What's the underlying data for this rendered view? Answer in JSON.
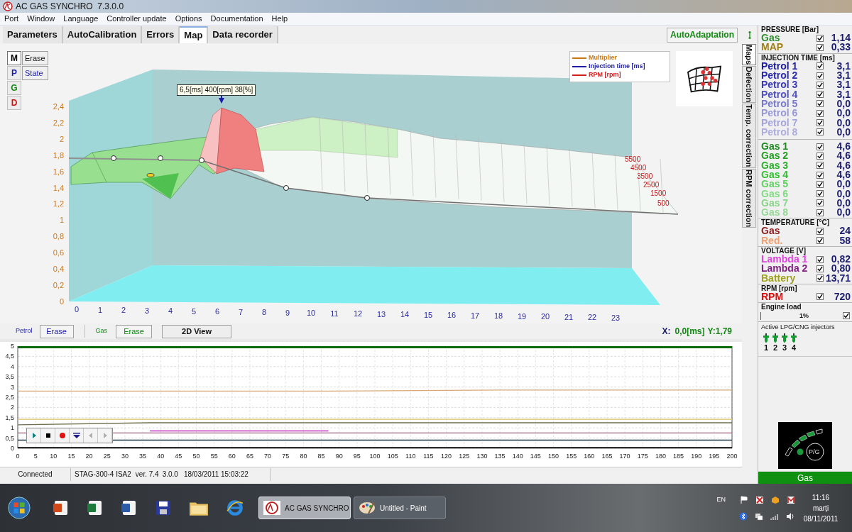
{
  "window": {
    "title": "AC GAS SYNCHRO  7.3.0.0"
  },
  "menu": [
    "Port",
    "Window",
    "Language",
    "Controller update",
    "Options",
    "Documentation",
    "Help"
  ],
  "tabs": [
    {
      "label": "Parameters",
      "selected": false
    },
    {
      "label": "AutoCalibration",
      "selected": false
    },
    {
      "label": "Errors",
      "selected": false
    },
    {
      "label": "Map",
      "selected": true
    },
    {
      "label": "Data recorder",
      "selected": false
    }
  ],
  "auto_adaptation": "AutoAdaptation",
  "side_tabs": [
    {
      "label": "Maps",
      "selected": true
    },
    {
      "label": "Defection",
      "selected": false
    },
    {
      "label": "Temp. correction",
      "selected": false
    },
    {
      "label": "RPM correction",
      "selected": false
    }
  ],
  "map": {
    "modes": [
      {
        "label": "M",
        "color": "#000000",
        "selected": true
      },
      {
        "label": "P",
        "color": "#1c1ca8",
        "selected": false
      },
      {
        "label": "G",
        "color": "#118811",
        "selected": false
      },
      {
        "label": "D",
        "color": "#cc1111",
        "selected": false
      }
    ],
    "mode_buttons": [
      "Erase",
      "State"
    ],
    "legend": [
      {
        "label": "Multiplier",
        "color": "#c87810"
      },
      {
        "label": "Injection time [ms]",
        "color": "#1c1ca8"
      },
      {
        "label": "RPM [rpm]",
        "color": "#d02020"
      }
    ],
    "tooltip": "6,5[ms] 400[rpm] 38[%]",
    "y_ticks": [
      "2,4",
      "2,2",
      "2",
      "1,8",
      "1,6",
      "1,4",
      "1,2",
      "1",
      "0,8",
      "0,6",
      "0,4",
      "0,2",
      "0"
    ],
    "x_ticks": [
      "0",
      "1",
      "2",
      "3",
      "4",
      "5",
      "6",
      "7",
      "8",
      "9",
      "10",
      "11",
      "12",
      "13",
      "14",
      "15",
      "16",
      "17",
      "18",
      "19",
      "20",
      "21",
      "22",
      "23"
    ],
    "rpm_ticks": [
      "5500",
      "4500",
      "3500",
      "2500",
      "1500",
      "500"
    ]
  },
  "map_controls": {
    "petrol_label": "Petrol",
    "petrol_erase": "Erase",
    "gas_label": "Gas",
    "gas_erase": "Erase",
    "view_button": "2D View",
    "x_label": "X:",
    "x_value": "0,0[ms]",
    "y_label": "Y:",
    "y_value": "1,79"
  },
  "recorder": {
    "chart_data": {
      "type": "line",
      "grid": true,
      "x": [
        0,
        37,
        87,
        135,
        200
      ],
      "xlim": [
        0,
        200
      ],
      "ylim": [
        0,
        5
      ],
      "xticks": [
        0,
        5,
        10,
        15,
        20,
        25,
        30,
        35,
        40,
        45,
        50,
        55,
        60,
        65,
        70,
        75,
        80,
        85,
        90,
        95,
        100,
        105,
        110,
        115,
        120,
        125,
        130,
        135,
        140,
        145,
        150,
        155,
        160,
        165,
        170,
        175,
        180,
        185,
        190,
        195,
        200
      ],
      "yticks": [
        0,
        {
          "value": 0.5,
          "label": "0,5"
        },
        1,
        {
          "value": 1.5,
          "label": "1,5"
        },
        2,
        {
          "value": 2.5,
          "label": "2,5"
        },
        3,
        {
          "value": 3.5,
          "label": "3,5"
        },
        4,
        {
          "value": 4.5,
          "label": "4,5"
        },
        5
      ],
      "series": [
        {
          "color": "#0b6a0b",
          "values": [
            4.95,
            4.95,
            4.95,
            4.95,
            4.95
          ]
        },
        {
          "color": "#d8a878",
          "values": [
            2.8,
            2.8,
            2.8,
            2.85,
            2.85
          ]
        },
        {
          "color": "#d8c060",
          "values": [
            1.42,
            1.42,
            1.42,
            1.42,
            1.42
          ]
        },
        {
          "color": "#707050",
          "values": [
            1.15,
            1.25,
            1.25,
            1.25,
            1.25
          ]
        },
        {
          "color": "#c030c0",
          "values": [
            null,
            0.85,
            0.85,
            null,
            null
          ]
        },
        {
          "color": "#a06080",
          "values": [
            0.75,
            0.75,
            0.75,
            0.75,
            0.75
          ]
        },
        {
          "color": "#203848",
          "values": [
            0.4,
            0.4,
            0.4,
            0.4,
            0.4
          ]
        },
        {
          "color": "#000000",
          "values": [
            0.05,
            0.05,
            0.05,
            0.05,
            0.05
          ]
        }
      ]
    },
    "player": [
      {
        "kind": "play",
        "disabled": false
      },
      {
        "kind": "stop",
        "disabled": false
      },
      {
        "kind": "record",
        "disabled": false
      },
      {
        "kind": "marker",
        "disabled": false
      },
      {
        "kind": "prev",
        "disabled": true
      },
      {
        "kind": "next",
        "disabled": true
      }
    ]
  },
  "status_bar": {
    "connection": "Connected",
    "device": "STAG-300-4 ISA2",
    "version": "ver. 7.4",
    "firmware": "3.0.0",
    "date": "18/03/2011 15:03:22"
  },
  "panel": {
    "sections": [
      {
        "title": "PRESSURE [Bar]",
        "groups": [
          [
            {
              "label": "Gas",
              "color": "#2e8b2e",
              "checked": true,
              "value": "1,14"
            },
            {
              "label": "MAP",
              "color": "#a08010",
              "checked": true,
              "value": "0,33"
            }
          ]
        ]
      },
      {
        "title": "INJECTION TIME [ms]",
        "groups": [
          [
            {
              "label": "Petrol 1",
              "color": "#1c1ca0",
              "checked": true,
              "value": "3,1"
            },
            {
              "label": "Petrol 2",
              "color": "#2a2ab0",
              "checked": true,
              "value": "3,1"
            },
            {
              "label": "Petrol 3",
              "color": "#3a3ab8",
              "checked": true,
              "value": "3,1"
            },
            {
              "label": "Petrol 4",
              "color": "#5050c0",
              "checked": true,
              "value": "3,1"
            },
            {
              "label": "Petrol 5",
              "color": "#7878cc",
              "checked": true,
              "value": "0,0"
            },
            {
              "label": "Petrol 6",
              "color": "#9898d8",
              "checked": true,
              "value": "0,0"
            },
            {
              "label": "Petrol 7",
              "color": "#a4a4dc",
              "checked": true,
              "value": "0,0"
            },
            {
              "label": "Petrol 8",
              "color": "#acacde",
              "checked": true,
              "value": "0,0"
            }
          ],
          [
            {
              "label": "Gas 1",
              "color": "#1f8a1f",
              "checked": true,
              "value": "4,6"
            },
            {
              "label": "Gas 2",
              "color": "#23a023",
              "checked": true,
              "value": "4,6"
            },
            {
              "label": "Gas 3",
              "color": "#2ab02a",
              "checked": true,
              "value": "4,6"
            },
            {
              "label": "Gas 4",
              "color": "#30c030",
              "checked": true,
              "value": "4,6"
            },
            {
              "label": "Gas 5",
              "color": "#60d060",
              "checked": true,
              "value": "0,0"
            },
            {
              "label": "Gas 6",
              "color": "#80dc80",
              "checked": true,
              "value": "0,0"
            },
            {
              "label": "Gas 7",
              "color": "#88d488",
              "checked": true,
              "value": "0,0"
            },
            {
              "label": "Gas 8",
              "color": "#94d894",
              "checked": true,
              "value": "0,0"
            }
          ]
        ]
      },
      {
        "title": "TEMPERATURE [°C]",
        "groups": [
          [
            {
              "label": "Gas",
              "color": "#8b1a1a",
              "checked": true,
              "value": "24"
            },
            {
              "label": "Red.",
              "color": "#f0a070",
              "checked": true,
              "value": "58"
            }
          ]
        ]
      },
      {
        "title": "VOLTAGE [V]",
        "groups": [
          [
            {
              "label": "Lambda 1",
              "color": "#e040e0",
              "checked": true,
              "value": "0,82"
            },
            {
              "label": "Lambda 2",
              "color": "#802080",
              "checked": true,
              "value": "0,80"
            },
            {
              "label": "Battery",
              "color": "#a0a020",
              "checked": true,
              "value": "13,71"
            }
          ]
        ]
      },
      {
        "title": "RPM [rpm]",
        "groups": [
          [
            {
              "label": "RPM",
              "color": "#e01010",
              "checked": true,
              "value": "720"
            }
          ]
        ]
      }
    ],
    "engine_load": {
      "title": "Engine load",
      "value": "1%",
      "level": 0.01,
      "checked": true
    },
    "injectors": {
      "title": "Active LPG/CNG injectors",
      "items": [
        {
          "label": "1",
          "active": true
        },
        {
          "label": "2",
          "active": true
        },
        {
          "label": "3",
          "active": true
        },
        {
          "label": "4",
          "active": true
        }
      ]
    },
    "fuel_switch": {
      "label": "P/G",
      "on": true
    },
    "fuel_status": "Gas"
  },
  "taskbar": {
    "tasks": [
      {
        "label": "AC GAS SYNCHRO",
        "selected": true
      },
      {
        "label": "Untitled - Paint",
        "selected": false
      }
    ],
    "language": "EN",
    "time": "11:16",
    "day": "marți",
    "date": "08/11/2011"
  }
}
